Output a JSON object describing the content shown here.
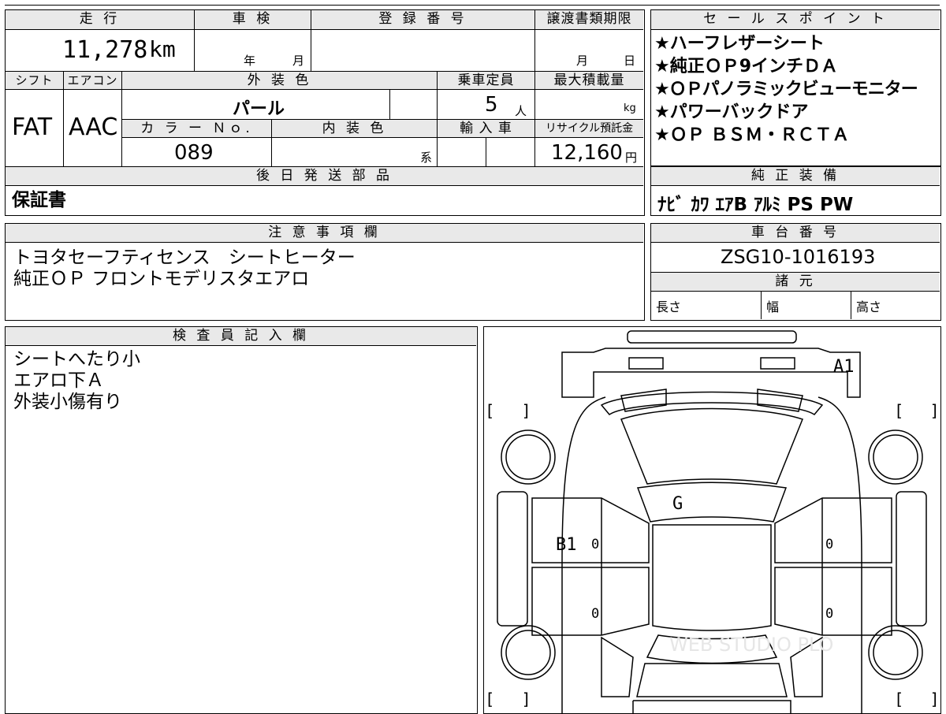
{
  "top_table": {
    "mileage_header": "走 行",
    "mileage": "11,278",
    "mileage_unit": "km",
    "shaken_header": "車 検",
    "shaken_year_unit": "年",
    "shaken_month_unit": "月",
    "registration_header": "登 録 番 号",
    "transfer_deadline_header": "譲渡書類期限",
    "transfer_month_unit": "月",
    "transfer_day_unit": "日",
    "shift_header": "シフト",
    "aircon_header": "エアコン",
    "exterior_color_header": "外 装 色",
    "capacity_header": "乗車定員",
    "max_load_header": "最大積載量",
    "shift_value": "FAT",
    "aircon_value": "AAC",
    "exterior_color_value": "パール",
    "capacity_value": "5",
    "capacity_unit": "人",
    "max_load_unit": "kg",
    "color_no_header": "カ ラ ー Ｎｏ.",
    "interior_color_header": "内 装 色",
    "import_header": "輸 入 車",
    "recycle_header": "リサイクル預託金",
    "color_no_value": "089",
    "interior_color_unit": "系",
    "recycle_value": "12,160",
    "recycle_unit": "円",
    "later_parts_header": "後 日 発 送 部 品",
    "later_parts_value": "保証書"
  },
  "sales_points": {
    "header": "セ ー ル ス ポ イ ン ト",
    "items": [
      "★ハーフレザーシート",
      "★純正ＯＰ9インチＤＡ",
      "★ＯＰパノラミックビューモニター",
      "★パワーバックドア",
      "★ＯＰ ＢＳＭ・ＲＣＴＡ"
    ]
  },
  "equipment": {
    "header": "純 正 装 備",
    "value": "ﾅﾋﾞ ｶﾜ ｴｱB ｱﾙﾐ PS PW"
  },
  "notes": {
    "header": "注 意 事 項 欄",
    "lines": [
      "トヨタセーフティセンス　シートヒーター",
      "純正ＯＰ フロントモデリスタエアロ"
    ]
  },
  "chassis": {
    "header": "車 台 番 号",
    "value": "ZSG10-1016193"
  },
  "specs": {
    "header": "諸 元",
    "length_label": "長さ",
    "width_label": "幅",
    "height_label": "高さ"
  },
  "inspector": {
    "header": "検 査 員 記 入 欄",
    "lines": [
      "シートへたり小",
      "エアロ下Ａ",
      "外装小傷有り"
    ]
  },
  "diagram": {
    "marks": [
      "A1",
      "G",
      "B1"
    ],
    "zero_labels": [
      "0",
      "0",
      "0",
      "0"
    ],
    "bracket_open": "[",
    "bracket_close": "]",
    "watermark": "WEB STUDIO PLO"
  }
}
